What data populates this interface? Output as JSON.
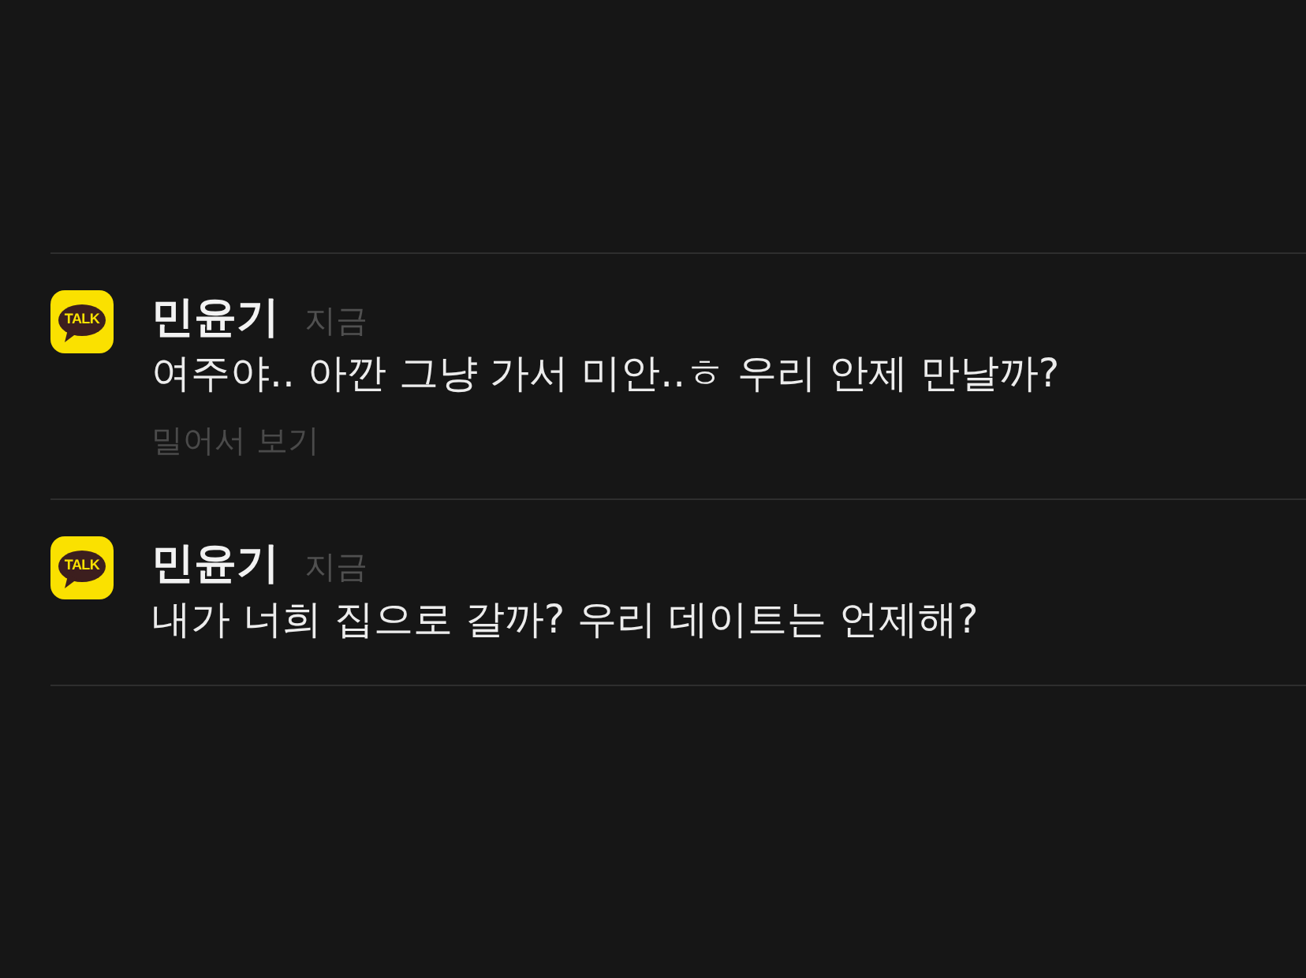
{
  "notifications": [
    {
      "app_icon_label": "TALK",
      "sender": "민윤기",
      "time": "지금",
      "message": "여주야.. 아깐 그냥 가서 미안..ㅎ 우리 안제 만날까?",
      "hint": "밀어서 보기"
    },
    {
      "app_icon_label": "TALK",
      "sender": "민윤기",
      "time": "지금",
      "message": "내가 너희 집으로 갈까? 우리 데이트는 언제해?"
    }
  ]
}
